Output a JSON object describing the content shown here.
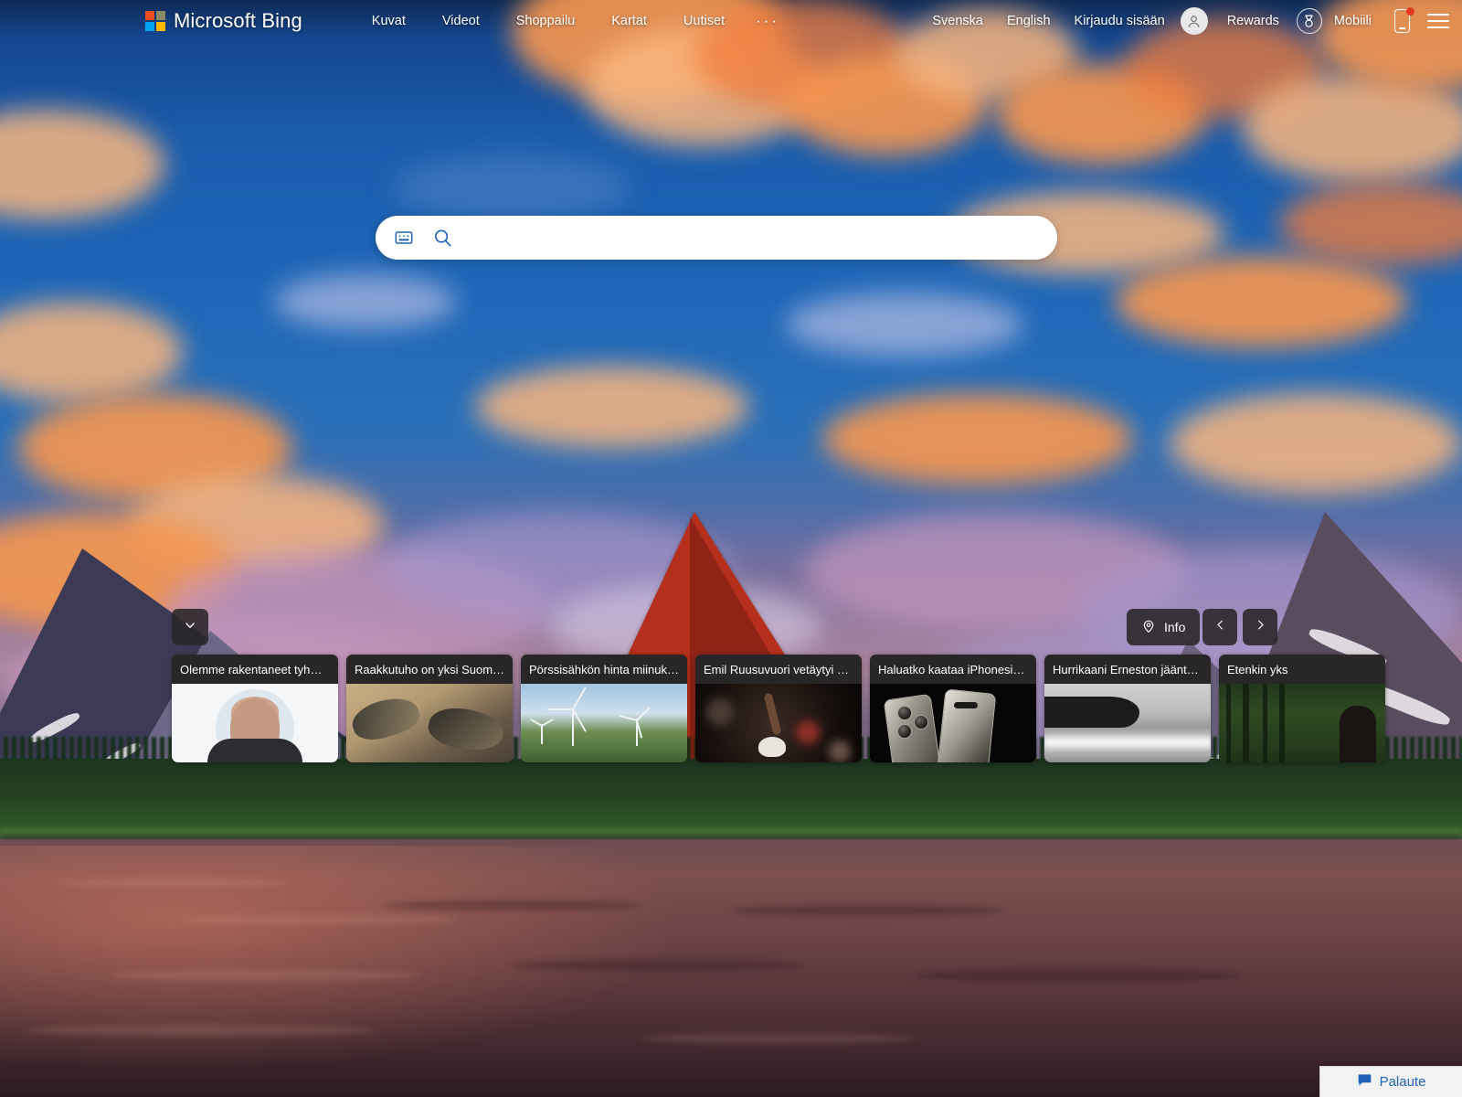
{
  "header": {
    "logo_text": "Microsoft Bing",
    "logo_icon": "microsoft-squares-icon",
    "nav": [
      {
        "label": "Kuvat"
      },
      {
        "label": "Videot"
      },
      {
        "label": "Shoppailu"
      },
      {
        "label": "Kartat"
      },
      {
        "label": "Uutiset"
      }
    ],
    "more_label": "···",
    "right": {
      "lang_sv": "Svenska",
      "lang_en": "English",
      "sign_in": "Kirjaudu sisään",
      "avatar_icon": "person-avatar-icon",
      "rewards": "Rewards",
      "rewards_icon": "medal-icon",
      "mobile": "Mobiili",
      "mobile_icon": "phone-icon",
      "menu_icon": "hamburger-menu-icon"
    }
  },
  "search": {
    "value": "",
    "placeholder": "",
    "keyboard_icon": "keyboard-icon",
    "search_icon": "search-icon"
  },
  "controls": {
    "collapse_icon": "chevron-down-icon",
    "info_label": "Info",
    "info_icon": "location-pin-icon",
    "prev_icon": "chevron-left-icon",
    "next_icon": "chevron-right-icon"
  },
  "cards": [
    {
      "title": "Olemme rakentaneet tyh…",
      "art": "art-person"
    },
    {
      "title": "Raakkutuho on yksi Suom…",
      "art": "art-shells"
    },
    {
      "title": "Pörssisähkön hinta miinuk…",
      "art": "art-wind"
    },
    {
      "title": "Emil Ruusuvuori vetäytyi …",
      "art": "art-sport"
    },
    {
      "title": "Haluatko kaataa iPhonesi…",
      "art": "art-phone"
    },
    {
      "title": "Hurrikaani Erneston jäänt…",
      "art": "art-coast"
    },
    {
      "title": "Etenkin yks",
      "art": "art-forest"
    }
  ],
  "feedback": {
    "label": "Palaute",
    "icon": "speech-bubble-icon"
  },
  "colors": {
    "brand_blue": "#1f62b8",
    "dark_chrome": "#292628",
    "ms_red": "#f25022",
    "ms_green": "#7fba00",
    "ms_blue": "#00a4ef",
    "ms_yellow": "#ffb900",
    "notification_red": "#e8371f"
  }
}
